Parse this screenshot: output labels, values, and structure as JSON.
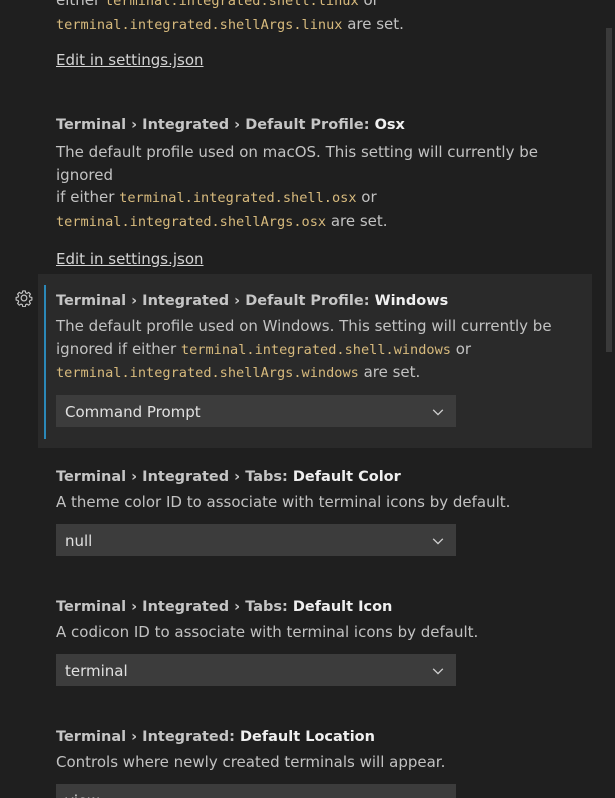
{
  "partial_top": {
    "line1_prefix": "either ",
    "line1_code": "terminal.integrated.shell.linux",
    "line1_suffix": " or",
    "line2_code": "terminal.integrated.shellArgs.linux",
    "line2_suffix": " are set.",
    "link": "Edit in settings.json"
  },
  "osx": {
    "title_prefix": "Terminal › Integrated › Default Profile: ",
    "title_key": "Osx",
    "desc_line1": "The default profile used on macOS. This setting will currently be ignored",
    "desc_line2_prefix": "if either ",
    "desc_code1": "terminal.integrated.shell.osx",
    "desc_line2_suffix": " or",
    "desc_code2": "terminal.integrated.shellArgs.osx",
    "desc_line3_suffix": " are set.",
    "link": "Edit in settings.json"
  },
  "windows": {
    "title_prefix": "Terminal › Integrated › Default Profile: ",
    "title_key": "Windows",
    "desc_line1": "The default profile used on Windows. This setting will currently be",
    "desc_line2_prefix": "ignored if either ",
    "desc_code1": "terminal.integrated.shell.windows",
    "desc_line2_suffix": " or",
    "desc_code2": "terminal.integrated.shellArgs.windows",
    "desc_line3_suffix": " are set.",
    "value": "Command Prompt"
  },
  "tabs_default_color": {
    "title_prefix": "Terminal › Integrated › Tabs: ",
    "title_key": "Default Color",
    "desc": "A theme color ID to associate with terminal icons by default.",
    "value": "null"
  },
  "tabs_default_icon": {
    "title_prefix": "Terminal › Integrated › Tabs: ",
    "title_key": "Default Icon",
    "desc": "A codicon ID to associate with terminal icons by default.",
    "value": "terminal"
  },
  "default_location": {
    "title_prefix": "Terminal › Integrated: ",
    "title_key": "Default Location",
    "desc": "Controls where newly created terminals will appear.",
    "value": "view"
  },
  "icons": {
    "gear": "gear-icon",
    "chevron": "chevron-down-icon"
  },
  "colors": {
    "background": "#1f1f1f",
    "focused_background": "#2a2a2a",
    "focus_bar": "#2b88b8",
    "code": "#d7ba7d",
    "dropdown": "#3c3c3c"
  }
}
